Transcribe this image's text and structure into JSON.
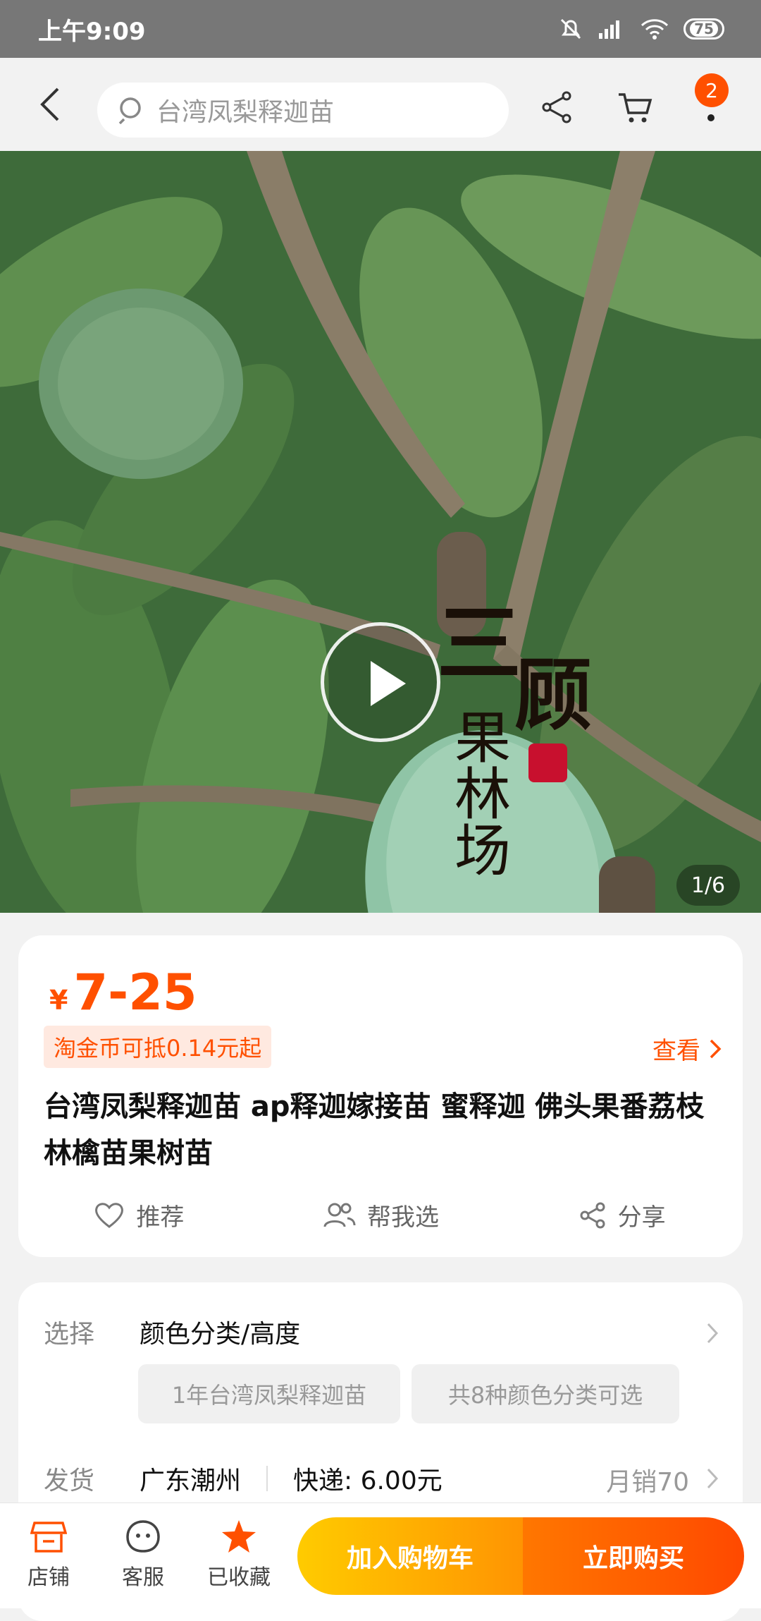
{
  "status_bar": {
    "time": "上午9:09",
    "battery": "75"
  },
  "nav": {
    "search_placeholder": "台湾凤梨释迦苗",
    "cart_badge": "2"
  },
  "gallery": {
    "counter": "1/6",
    "watermark_text": "三顾 果林场"
  },
  "price_card": {
    "currency": "¥",
    "price": "7-25",
    "coin_offer": "淘金币可抵0.14元起",
    "view_link": "查看",
    "title": "台湾凤梨释迦苗 ap释迦嫁接苗 蜜释迦 佛头果番荔枝 林檎苗果树苗",
    "actions": [
      {
        "label": "推荐",
        "icon": "heart-icon"
      },
      {
        "label": "帮我选",
        "icon": "people-icon"
      },
      {
        "label": "分享",
        "icon": "share-icon"
      }
    ]
  },
  "options_card": {
    "select_label": "选择",
    "select_value": "颜色分类/高度",
    "chips": [
      "1年台湾凤梨释迦苗",
      "共8种颜色分类可选"
    ],
    "ship_label": "发货",
    "ship_origin": "广东潮州",
    "ship_fee": "快递: 6.00元",
    "monthly_sales": "月销70"
  },
  "bottom_bar": {
    "store": "店铺",
    "service": "客服",
    "favorited": "已收藏",
    "add_cart": "加入购物车",
    "buy_now": "立即购买"
  },
  "colors": {
    "accent": "#ff5000",
    "cart_button": "#ffb300",
    "buy_button": "#ff5a00"
  }
}
